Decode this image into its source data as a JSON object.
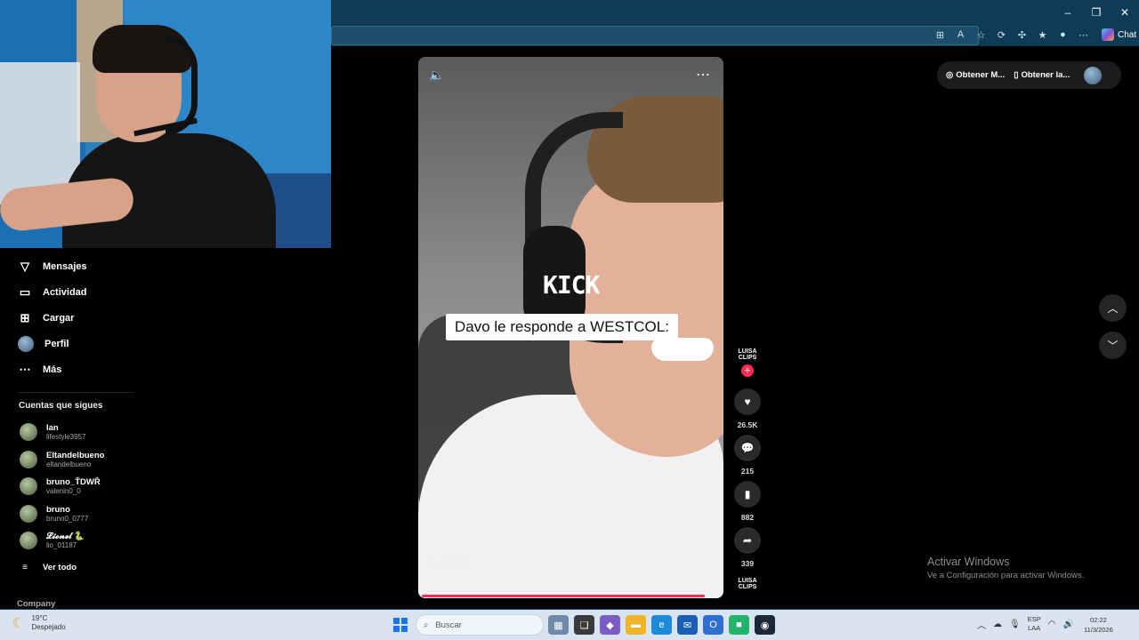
{
  "browser": {
    "chat_label": "Chat",
    "window_controls": {
      "minimize": "–",
      "restore": "❐",
      "close": "✕"
    }
  },
  "sidebar": {
    "items": [
      {
        "label": "Mensajes",
        "icon": "send-icon"
      },
      {
        "label": "Actividad",
        "icon": "inbox-icon"
      },
      {
        "label": "Cargar",
        "icon": "upload-icon"
      },
      {
        "label": "Perfil",
        "icon": "avatar"
      },
      {
        "label": "Más",
        "icon": "more-icon"
      }
    ],
    "following_title": "Cuentas que sigues",
    "following": [
      {
        "name": "Ian",
        "handle": "lifestyle3957"
      },
      {
        "name": "Eltandelbueno",
        "handle": "eltandelbueno"
      },
      {
        "name": "bruno_ŤDWŘ",
        "handle": "valenin0_0"
      },
      {
        "name": "bruno",
        "handle": "bruno0_0777"
      },
      {
        "name": "𝓛𝓲𝓸𝓷𝓮𝓵 🐍",
        "handle": "lio_01187"
      }
    ],
    "see_all": "Ver todo",
    "company": "Company"
  },
  "video": {
    "brand_overlay": "KICK",
    "caption": "Davo le responde a WESTCOL:",
    "author": "luisaclips1",
    "hashtags": "#argentinaᴬᴿᴬᴿ #davo #davooxeneize @davooxeneize",
    "creator_badge": "LUISA CLIPS",
    "likes": "26.5K",
    "comments": "215",
    "saves": "882",
    "shares": "339"
  },
  "get_app": {
    "item1": "Obtener M...",
    "item2": "Obtener la..."
  },
  "watermark": {
    "title": "Activar Windows",
    "subtitle": "Ve a Configuración para activar Windows."
  },
  "taskbar": {
    "weather_temp": "19°C",
    "weather_cond": "Despejado",
    "search_placeholder": "Buscar",
    "lang_line1": "ESP",
    "lang_line2": "LAA",
    "time": "02:22",
    "date": "11/3/2026"
  },
  "colors": {
    "titlebar": "#0f3b57",
    "accent_red": "#ff2c55",
    "taskbar": "#d9e4f0"
  }
}
